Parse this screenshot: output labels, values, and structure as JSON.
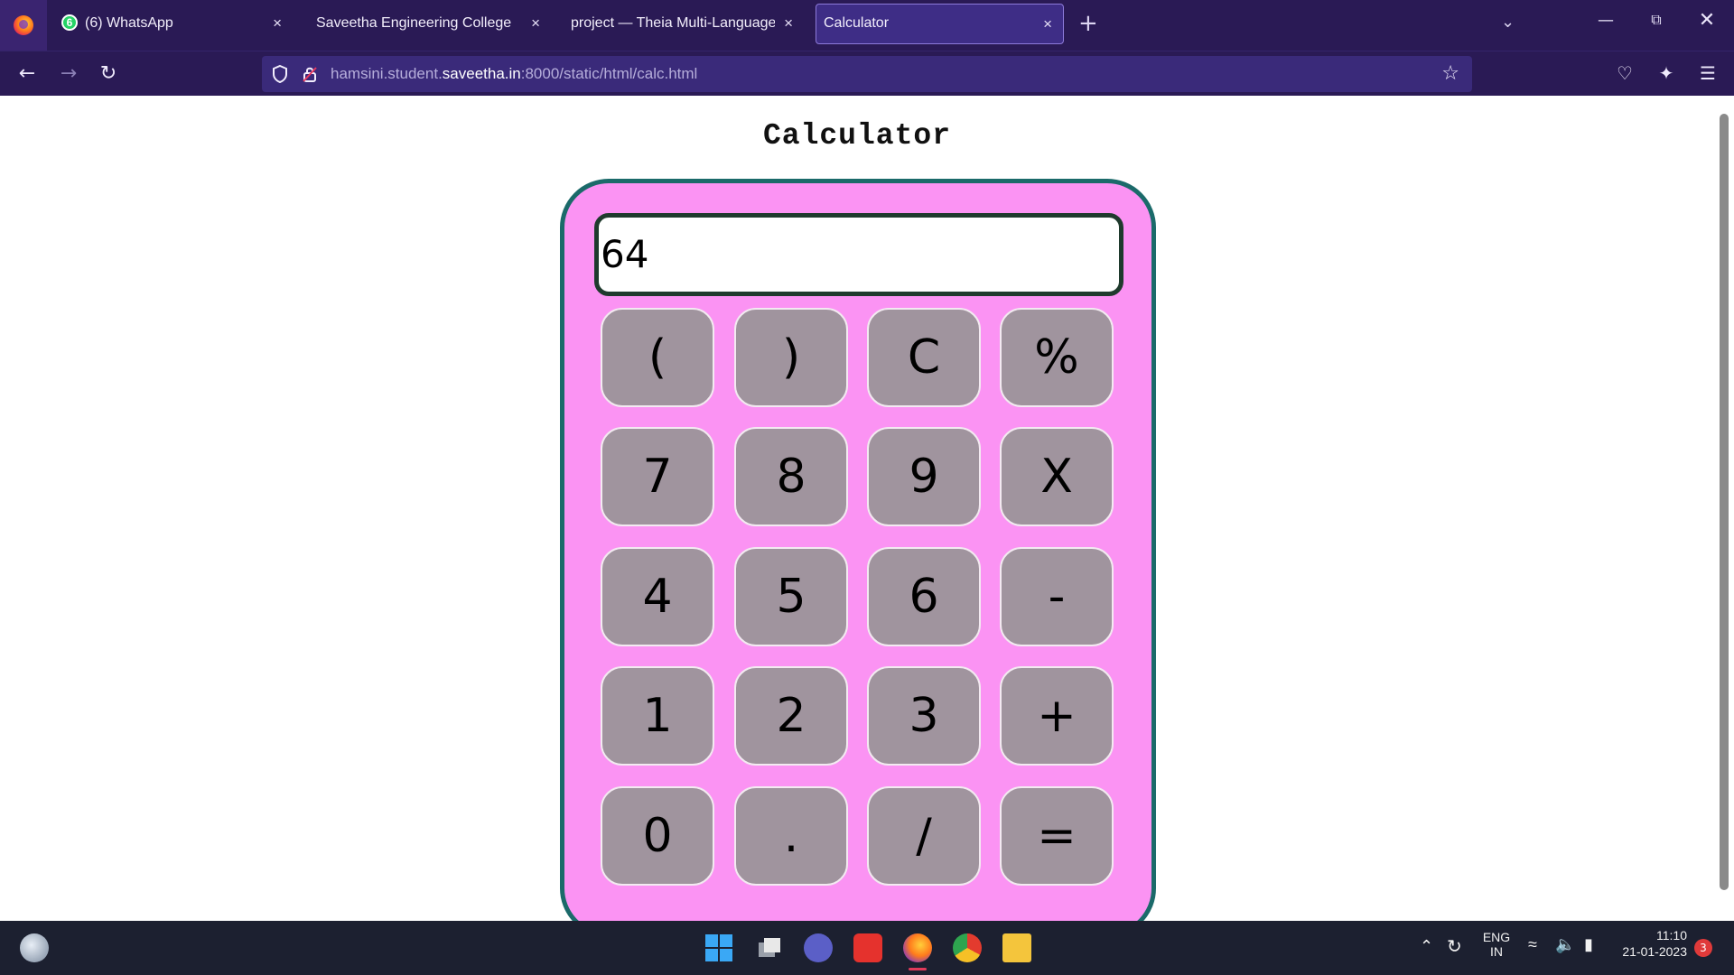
{
  "browser": {
    "tabs": [
      {
        "title": "(6) WhatsApp",
        "badge": "6",
        "close": "×",
        "active": false
      },
      {
        "title": "Saveetha Engineering College",
        "close": "×",
        "active": false
      },
      {
        "title": "project — Theia Multi-Language Ex",
        "close": "×",
        "active": false
      },
      {
        "title": "Calculator",
        "close": "×",
        "active": true
      }
    ],
    "new_tab": "+",
    "url": {
      "prefix": "hamsini.student.",
      "domain": "saveetha.in",
      "suffix": ":8000/static/html/calc.html"
    }
  },
  "page": {
    "title": "Calculator",
    "display_value": "64",
    "keys": [
      [
        "(",
        ")",
        "C",
        "%"
      ],
      [
        "7",
        "8",
        "9",
        "X"
      ],
      [
        "4",
        "5",
        "6",
        "-"
      ],
      [
        "1",
        "2",
        "3",
        "+"
      ],
      [
        "0",
        ".",
        "/",
        "="
      ]
    ]
  },
  "taskbar": {
    "language": "ENG",
    "region": "IN",
    "time": "11:10",
    "date": "21-01-2023",
    "notification_count": "3"
  },
  "colors": {
    "calc_body": "#fb93f3",
    "calc_border": "#1b6a6a",
    "key_bg": "#a0949e",
    "chrome_bg": "#2a1a55"
  }
}
